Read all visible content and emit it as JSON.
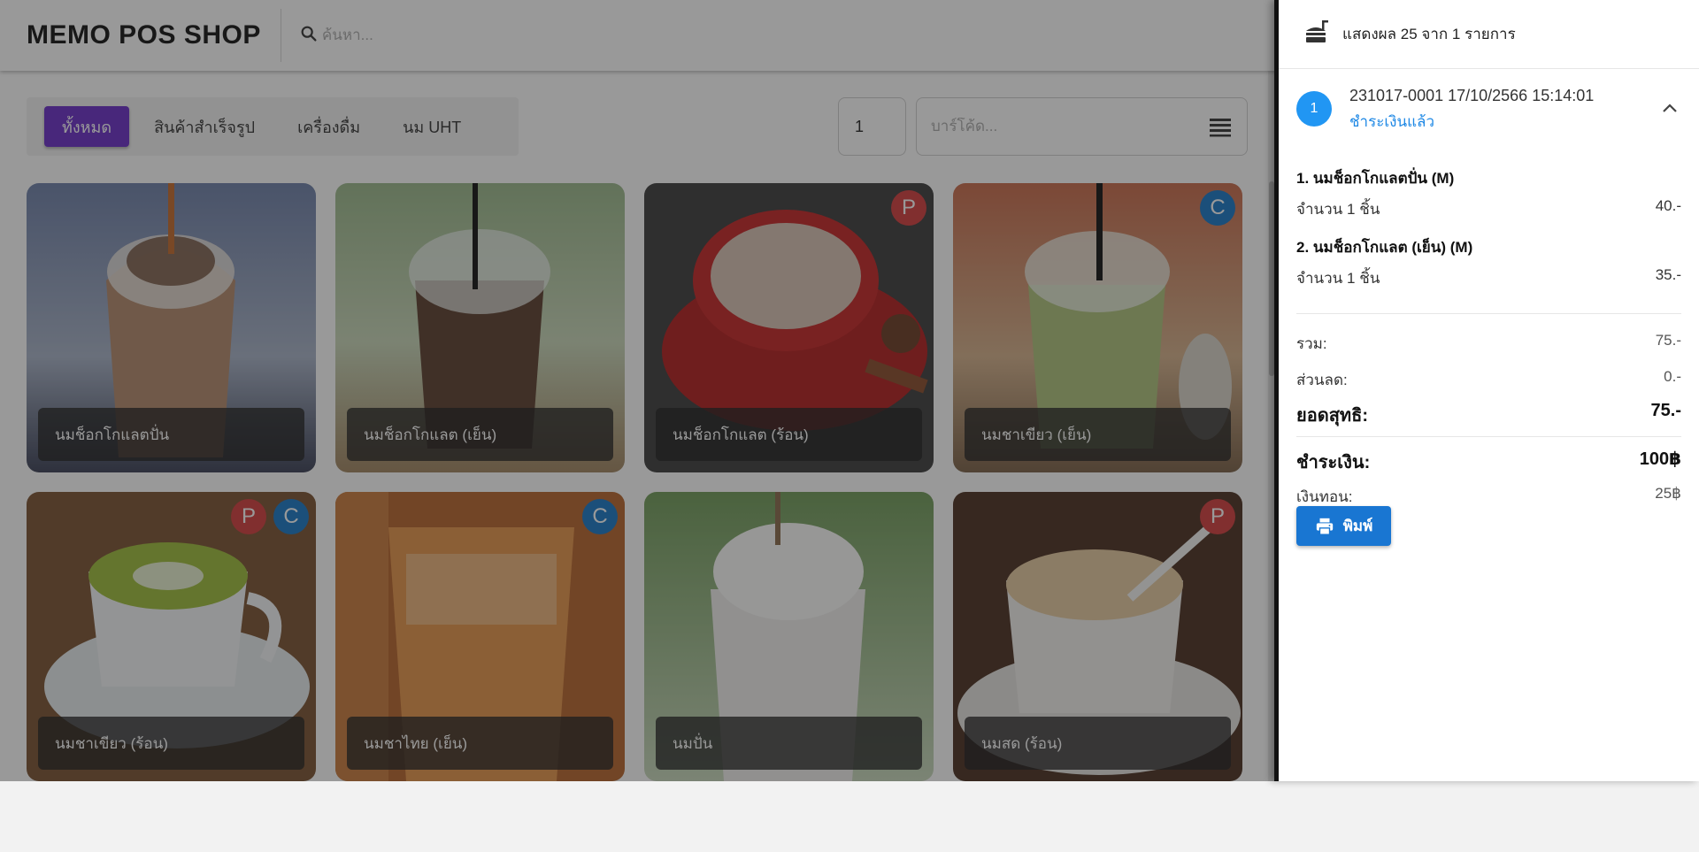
{
  "header": {
    "brand": "MEMO POS SHOP",
    "search_placeholder": "ค้นหา..."
  },
  "filters": {
    "categories": [
      {
        "label": "ทั้งหมด",
        "active": true
      },
      {
        "label": "สินค้าสำเร็จรูป",
        "active": false
      },
      {
        "label": "เครื่องดื่ม",
        "active": false
      },
      {
        "label": "นม UHT",
        "active": false
      }
    ],
    "quantity_value": "1",
    "barcode_placeholder": "บาร์โค้ด..."
  },
  "products": [
    {
      "name": "นมช็อกโกแลตปั่น",
      "badges": []
    },
    {
      "name": "นมช็อกโกแลต (เย็น)",
      "badges": []
    },
    {
      "name": "นมช็อกโกแลต (ร้อน)",
      "badges": [
        "P"
      ]
    },
    {
      "name": "นมชาเขียว (เย็น)",
      "badges": [
        "C"
      ]
    },
    {
      "name": "นมชาเขียว (ร้อน)",
      "badges": [
        "P",
        "C"
      ]
    },
    {
      "name": "นมชาไทย (เย็น)",
      "badges": [
        "C"
      ]
    },
    {
      "name": "นมปั่น",
      "badges": []
    },
    {
      "name": "นมสด (ร้อน)",
      "badges": [
        "P"
      ]
    }
  ],
  "drawer": {
    "header_text": "แสดงผล 25 จาก 1 รายการ",
    "order": {
      "number": "1",
      "title": "231017-0001 17/10/2566 15:14:01",
      "status": "ชำระเงินแล้ว"
    },
    "items": [
      {
        "name": "1. นมช็อกโกแลตปั่น (M)",
        "qty": "จำนวน 1 ชิ้น",
        "price": "40.-"
      },
      {
        "name": "2. นมช็อกโกแลต (เย็น) (M)",
        "qty": "จำนวน 1 ชิ้น",
        "price": "35.-"
      }
    ],
    "summary": {
      "total_label": "รวม:",
      "total_value": "75.-",
      "discount_label": "ส่วนลด:",
      "discount_value": "0.-",
      "net_label": "ยอดสุทธิ:",
      "net_value": "75.-",
      "paid_label": "ชำระเงิน:",
      "paid_value": "100฿",
      "change_label": "เงินทอน:",
      "change_value": "25฿"
    },
    "print_label": "พิมพ์"
  },
  "colors": {
    "accent_purple": "#6a2ec8",
    "primary_blue": "#1976d2",
    "badge_p": "#d23c3c",
    "badge_c": "#1776c6"
  }
}
